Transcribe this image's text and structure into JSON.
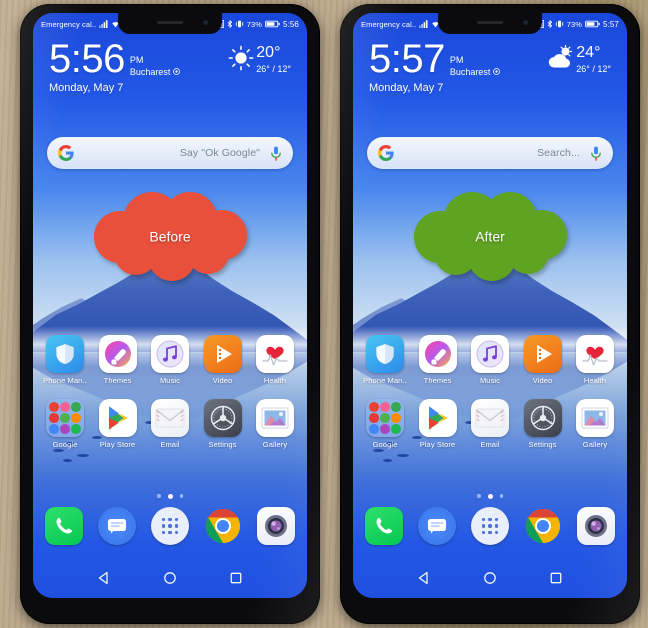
{
  "scene": {
    "background_color": "#b6a385",
    "surface": "wooden-desk"
  },
  "phones": [
    {
      "id": "before",
      "callout": {
        "label": "Before",
        "color": "#e8503c"
      },
      "status_bar": {
        "carrier": "Emergency cal..",
        "icons": [
          "signal-icon",
          "wifi-icon",
          "nfc-icon",
          "bluetooth-icon",
          "vibrate-icon"
        ],
        "battery_percent": "73%",
        "clock": "5:56"
      },
      "clock_widget": {
        "time": "5:56",
        "ampm": "PM",
        "city": "Bucharest",
        "date": "Monday, May 7",
        "weather": {
          "icon": "sun-icon",
          "temp": "20°",
          "range": "26° / 12°"
        }
      },
      "search_bar": {
        "text": "Say \"Ok Google\"",
        "logo": "google-g-icon",
        "mic": "microphone-icon"
      }
    },
    {
      "id": "after",
      "callout": {
        "label": "After",
        "color": "#5fa323"
      },
      "status_bar": {
        "carrier": "Emergency cal..",
        "icons": [
          "signal-icon",
          "wifi-icon",
          "nfc-icon",
          "bluetooth-icon",
          "vibrate-icon"
        ],
        "battery_percent": "73%",
        "clock": "5:57"
      },
      "clock_widget": {
        "time": "5:57",
        "ampm": "PM",
        "city": "Bucharest",
        "date": "Monday, May 7",
        "weather": {
          "icon": "partly-cloudy-icon",
          "temp": "24°",
          "range": "26° / 12°"
        }
      },
      "search_bar": {
        "text": "Search...",
        "logo": "google-g-icon",
        "mic": "microphone-icon"
      }
    }
  ],
  "home_screen": {
    "app_rows": [
      [
        {
          "label": "Phone Man..",
          "icon": "phone-manager-icon"
        },
        {
          "label": "Themes",
          "icon": "themes-icon"
        },
        {
          "label": "Music",
          "icon": "music-icon"
        },
        {
          "label": "Video",
          "icon": "video-icon"
        },
        {
          "label": "Health",
          "icon": "health-icon"
        }
      ],
      [
        {
          "label": "Google",
          "icon": "google-folder-icon"
        },
        {
          "label": "Play Store",
          "icon": "play-store-icon"
        },
        {
          "label": "Email",
          "icon": "email-icon"
        },
        {
          "label": "Settings",
          "icon": "settings-icon"
        },
        {
          "label": "Gallery",
          "icon": "gallery-icon"
        }
      ]
    ],
    "page_dots": {
      "count": 3,
      "active_index": 1
    },
    "dock": [
      {
        "name": "phone-app-icon",
        "label": "Phone"
      },
      {
        "name": "messages-app-icon",
        "label": "Messages"
      },
      {
        "name": "app-drawer-icon",
        "label": "App drawer"
      },
      {
        "name": "chrome-app-icon",
        "label": "Chrome"
      },
      {
        "name": "camera-app-icon",
        "label": "Camera"
      }
    ],
    "nav_bar": [
      {
        "name": "back-button",
        "glyph": "triangle"
      },
      {
        "name": "home-button",
        "glyph": "circle"
      },
      {
        "name": "recents-button",
        "glyph": "square"
      }
    ]
  }
}
